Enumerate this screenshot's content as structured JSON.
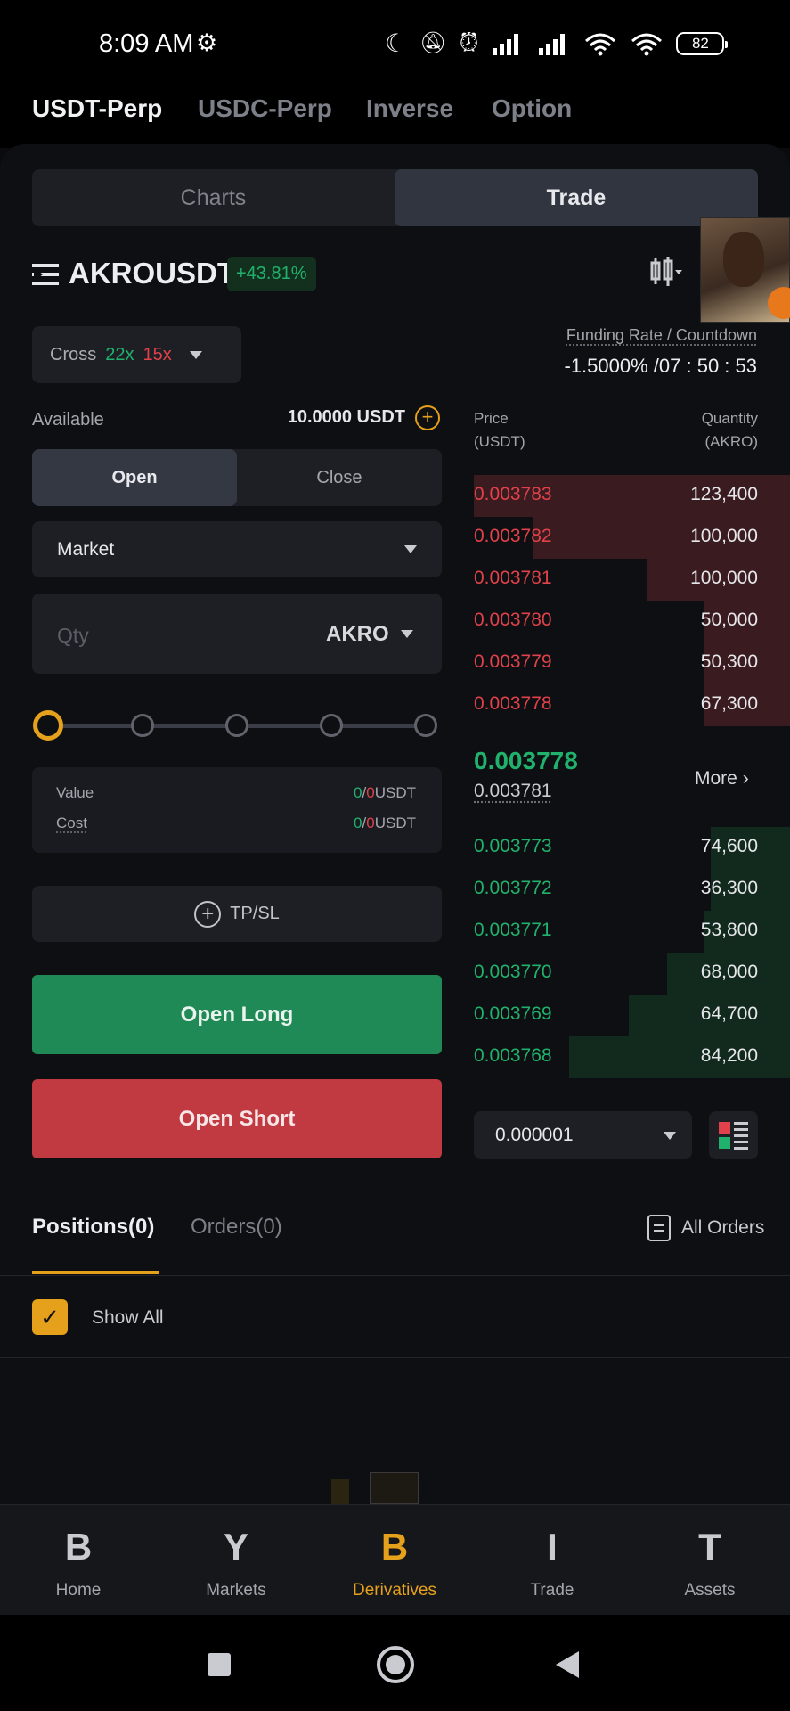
{
  "status_bar": {
    "time": "8:09 AM",
    "battery": "82"
  },
  "top_tabs": [
    "USDT-Perp",
    "USDC-Perp",
    "Inverse",
    "Option"
  ],
  "view_toggle": {
    "charts": "Charts",
    "trade": "Trade"
  },
  "symbol": {
    "name": "AKROUSDT",
    "change": "+43.81%"
  },
  "margin": {
    "mode": "Cross",
    "long_leverage": "22x",
    "short_leverage": "15x"
  },
  "funding": {
    "label": "Funding Rate / Countdown",
    "value": "-1.5000% /07 : 50 : 53"
  },
  "available": {
    "label": "Available",
    "value": "10.0000 USDT"
  },
  "open_close": {
    "open": "Open",
    "close": "Close"
  },
  "order_type": "Market",
  "qty": {
    "placeholder": "Qty",
    "unit": "AKRO"
  },
  "slider": {
    "level": 0
  },
  "value_cost": {
    "value_label": "Value",
    "cost_label": "Cost",
    "value_a": "0",
    "value_b": "0",
    "cost_a": "0",
    "cost_b": "0",
    "unit": "USDT",
    "sep": "/"
  },
  "tpsl": "TP/SL",
  "buttons": {
    "open_long": "Open Long",
    "open_short": "Open Short"
  },
  "orderbook": {
    "price_header": "Price",
    "price_unit": "(USDT)",
    "qty_header": "Quantity",
    "qty_unit": "(AKRO)",
    "asks": [
      {
        "price": "0.003783",
        "qty": "123,400",
        "depth": 1.0
      },
      {
        "price": "0.003782",
        "qty": "100,000",
        "depth": 0.81
      },
      {
        "price": "0.003781",
        "qty": "100,000",
        "depth": 0.45
      },
      {
        "price": "0.003780",
        "qty": "50,000",
        "depth": 0.27
      },
      {
        "price": "0.003779",
        "qty": "50,300",
        "depth": 0.27
      },
      {
        "price": "0.003778",
        "qty": "67,300",
        "depth": 0.27
      }
    ],
    "last_price": "0.003778",
    "mark_price": "0.003781",
    "more": "More",
    "bids": [
      {
        "price": "0.003773",
        "qty": "74,600",
        "depth": 0.25
      },
      {
        "price": "0.003772",
        "qty": "36,300",
        "depth": 0.25
      },
      {
        "price": "0.003771",
        "qty": "53,800",
        "depth": 0.27
      },
      {
        "price": "0.003770",
        "qty": "68,000",
        "depth": 0.39
      },
      {
        "price": "0.003769",
        "qty": "64,700",
        "depth": 0.51
      },
      {
        "price": "0.003768",
        "qty": "84,200",
        "depth": 0.7
      }
    ],
    "tick_size": "0.000001"
  },
  "positions": {
    "tab_positions": "Positions(0)",
    "tab_orders": "Orders(0)",
    "all_orders": "All Orders",
    "show_all": "Show All"
  },
  "bottom_nav": [
    {
      "glyph": "B",
      "label": "Home"
    },
    {
      "glyph": "Y",
      "label": "Markets"
    },
    {
      "glyph": "B",
      "label": "Derivatives"
    },
    {
      "glyph": "I",
      "label": "Trade"
    },
    {
      "glyph": "T",
      "label": "Assets"
    }
  ],
  "colors": {
    "green": "#20b26c",
    "red": "#e0414a",
    "accent": "#e5a11b"
  }
}
